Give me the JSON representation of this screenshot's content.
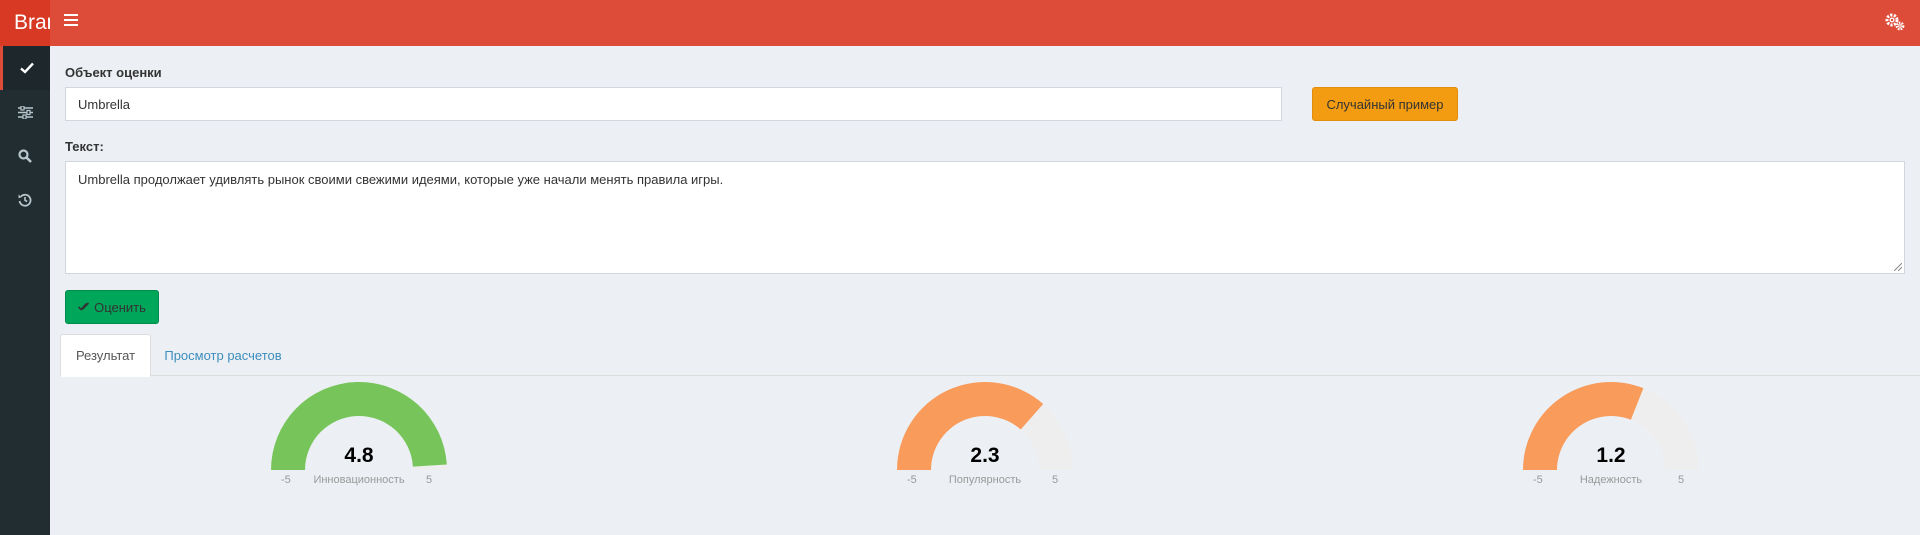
{
  "header": {
    "brand": "Brand"
  },
  "form": {
    "object_label": "Объект оценки",
    "object_value": "Umbrella",
    "random_button": "Случайный пример",
    "text_label": "Текст:",
    "text_value": "Umbrella продолжает удивлять рынок своими свежими идеями, которые уже начали менять правила игры.",
    "evaluate_button": "Оценить"
  },
  "tabs": [
    {
      "label": "Результат",
      "active": true
    },
    {
      "label": "Просмотр расчетов",
      "active": false
    }
  ],
  "gauges": [
    {
      "name": "Инновационность",
      "value": 4.8,
      "display": "4.8",
      "min": -5,
      "max": 5,
      "min_label": "-5",
      "max_label": "5",
      "color": "#77c55a"
    },
    {
      "name": "Популярность",
      "value": 2.3,
      "display": "2.3",
      "min": -5,
      "max": 5,
      "min_label": "-5",
      "max_label": "5",
      "color": "#f89b5b"
    },
    {
      "name": "Надежность",
      "value": 1.2,
      "display": "1.2",
      "min": -5,
      "max": 5,
      "min_label": "-5",
      "max_label": "5",
      "color": "#f89b5b"
    }
  ],
  "colors": {
    "header": "#dd4b39",
    "sidebar": "#222d32",
    "random_button": "#f39c12",
    "evaluate_button": "#00a65a",
    "gauge_track": "#eeeeee"
  },
  "icons": {
    "sidebar": [
      "check-icon",
      "sliders-icon",
      "search-icon",
      "history-icon"
    ],
    "header_right": "gears-icon",
    "menu": "hamburger-icon"
  }
}
